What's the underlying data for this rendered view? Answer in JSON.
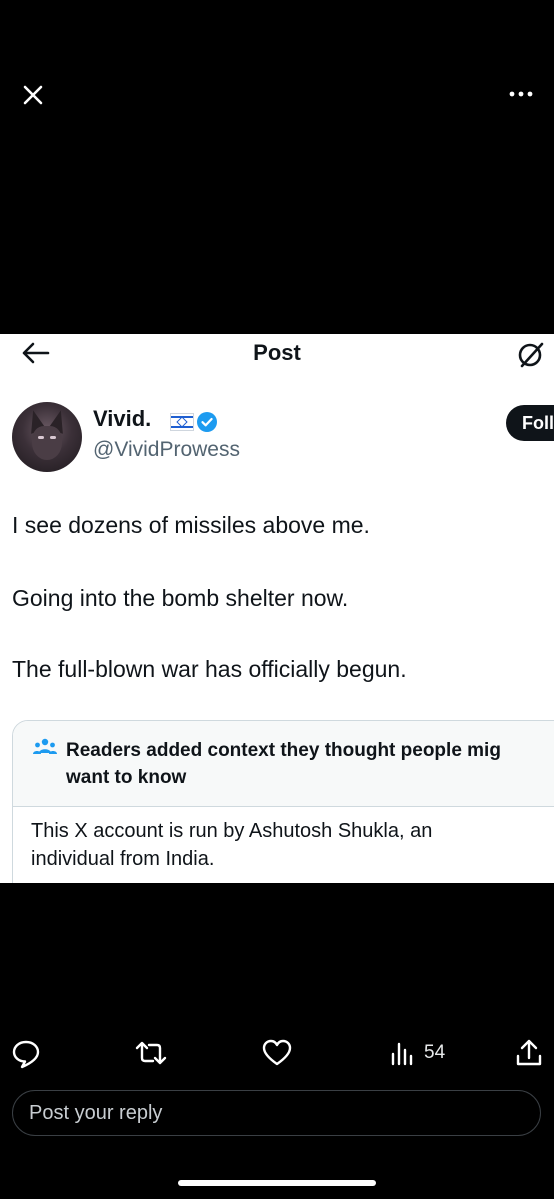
{
  "viewer": {
    "close_icon": "close-icon",
    "more_icon": "more-horizontal-icon"
  },
  "screenshot": {
    "header": {
      "back_icon": "back-arrow-icon",
      "title": "Post",
      "right_icon": "grok-icon"
    },
    "author": {
      "display_name": "Vivid.",
      "flag": "israel-flag-icon",
      "verified": "verified-badge-icon",
      "handle": "@VividProwess",
      "follow_label": "Foll"
    },
    "tweet_lines": [
      "I see dozens of missiles above me.",
      "Going into the bomb shelter now.",
      "The full-blown war has officially begun."
    ],
    "community_note": {
      "icon": "people-icon",
      "title_line1": "Readers added context they thought people mig",
      "title_line2": "want to know",
      "body_line1": "This X account is run by Ashutosh Shukla, an",
      "body_line2": "individual from India."
    }
  },
  "actions": {
    "reply_icon": "reply-icon",
    "retweet_icon": "retweet-icon",
    "like_icon": "heart-icon",
    "views_icon": "views-icon",
    "views_count": "54",
    "share_icon": "share-icon"
  },
  "reply": {
    "placeholder": "Post your reply"
  },
  "colors": {
    "background": "#000000",
    "verified_blue": "#1d9bf0",
    "text_dark": "#0f1419",
    "text_muted": "#536471"
  }
}
